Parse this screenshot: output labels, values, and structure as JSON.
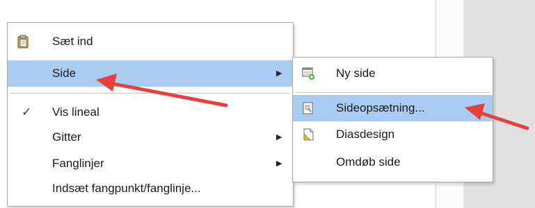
{
  "context_menu": {
    "items": [
      {
        "label": "Sæt ind",
        "icon": "clipboard-paste-icon"
      },
      {
        "label": "Side",
        "has_submenu": true,
        "highlighted": true
      },
      {
        "label": "Vis lineal",
        "checked": true
      },
      {
        "label": "Gitter",
        "has_submenu": true
      },
      {
        "label": "Fanglinjer",
        "has_submenu": true
      },
      {
        "label": "Indsæt fangpunkt/fanglinje..."
      }
    ]
  },
  "submenu": {
    "items": [
      {
        "label": "Ny side",
        "icon": "new-page-icon"
      },
      {
        "label": "Sideopsætning...",
        "icon": "page-setup-icon",
        "highlighted": true
      },
      {
        "label": "Diasdesign",
        "icon": "slide-design-icon"
      },
      {
        "label": "Omdøb side"
      }
    ]
  },
  "colors": {
    "highlight": "#a9cdf2",
    "annotation_arrow": "#e8403a"
  },
  "glyphs": {
    "submenu_arrow": "▶",
    "check": "✓"
  }
}
